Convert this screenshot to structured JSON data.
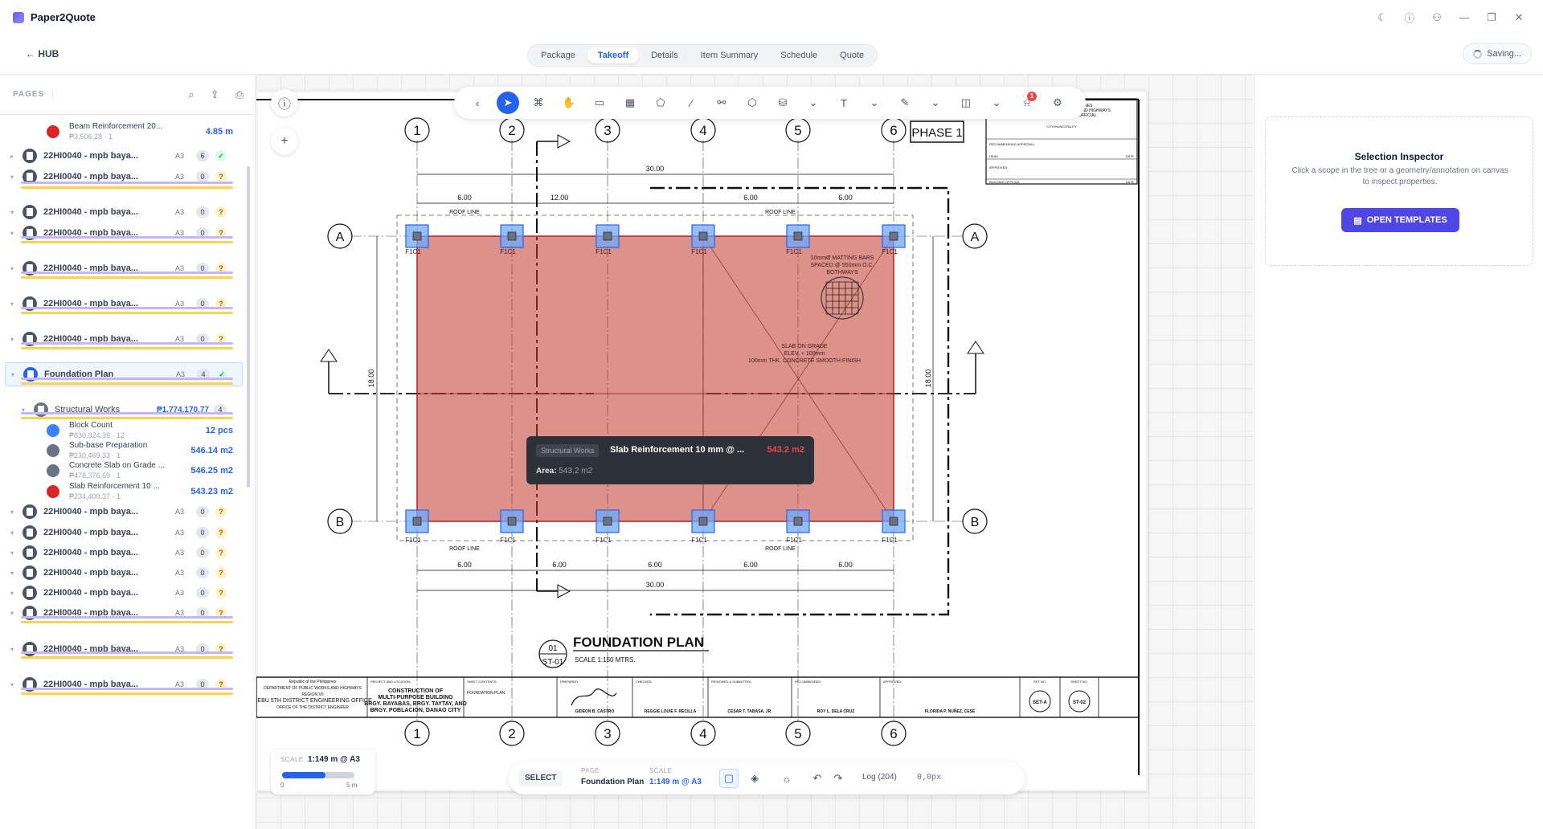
{
  "app": {
    "name": "Paper2Quote"
  },
  "nav": {
    "hub": "← HUB",
    "tabs": [
      "Package",
      "Takeoff",
      "Details",
      "Item Summary",
      "Schedule",
      "Quote"
    ],
    "saving": "Saving..."
  },
  "left": {
    "pages_label": "PAGES",
    "top_item": {
      "name": "Beam Reinforcement 20...",
      "cost": "₱3,506.28 · 1",
      "value": "4.85 m"
    },
    "pages": [
      {
        "label": "22HI0040 - mpb baya...",
        "size": "A3",
        "count": "6",
        "status": "✓"
      },
      {
        "label": "22HI0040 - mpb baya...",
        "size": "A3",
        "count": "0",
        "status": "?"
      },
      {
        "label": "22HI0040 - mpb baya...",
        "size": "A3",
        "count": "0",
        "status": "?"
      },
      {
        "label": "22HI0040 - mpb baya...",
        "size": "A3",
        "count": "0",
        "status": "?"
      },
      {
        "label": "22HI0040 - mpb baya...",
        "size": "A3",
        "count": "0",
        "status": "?"
      },
      {
        "label": "22HI0040 - mpb baya...",
        "size": "A3",
        "count": "0",
        "status": "?"
      },
      {
        "label": "22HI0040 - mpb baya...",
        "size": "A3",
        "count": "0",
        "status": "?"
      },
      {
        "label": "Foundation Plan",
        "size": "A3",
        "count": "4",
        "status": "✓"
      },
      {
        "label": "22HI0040 - mpb baya...",
        "size": "A3",
        "count": "0",
        "status": "?"
      },
      {
        "label": "22HI0040 - mpb baya...",
        "size": "A3",
        "count": "0",
        "status": "?"
      },
      {
        "label": "22HI0040 - mpb baya...",
        "size": "A3",
        "count": "0",
        "status": "?"
      },
      {
        "label": "22HI0040 - mpb baya...",
        "size": "A3",
        "count": "0",
        "status": "?"
      },
      {
        "label": "22HI0040 - mpb baya...",
        "size": "A3",
        "count": "0",
        "status": "?"
      },
      {
        "label": "22HI0040 - mpb baya...",
        "size": "A3",
        "count": "0",
        "status": "?"
      },
      {
        "label": "22HI0040 - mpb baya...",
        "size": "A3",
        "count": "0",
        "status": "?"
      },
      {
        "label": "22HI0040 - mpb baya...",
        "size": "A3",
        "count": "0",
        "status": "?"
      }
    ],
    "group": {
      "name": "Structural Works",
      "total": "₱1,774,170.77",
      "count": "4"
    },
    "items": [
      {
        "name": "Block Count",
        "cost": "₱830,924.39 · 12",
        "value": "12 pcs",
        "color": "#3b82f6"
      },
      {
        "name": "Sub-base Preparation",
        "cost": "₱230,469.33 · 1",
        "value": "546.14 m2",
        "color": "#6b7280"
      },
      {
        "name": "Concrete Slab on Grade ...",
        "cost": "₱478,376.69 · 1",
        "value": "546.25 m2",
        "color": "#6b7280"
      },
      {
        "name": "Slab Reinforcement 10 ...",
        "cost": "₱234,400.37 · 1",
        "value": "543.23 m2",
        "color": "#dc2626"
      }
    ]
  },
  "drawing": {
    "grid_numbers": [
      "1",
      "2",
      "3",
      "4",
      "5",
      "6"
    ],
    "grid_letters": [
      "A",
      "B"
    ],
    "phase": "PHASE 1",
    "dims_top": [
      "6.00",
      "12.00",
      "6.00",
      "6.00"
    ],
    "dims_bottom": [
      "6.00",
      "6.00",
      "6.00",
      "6.00",
      "6.00"
    ],
    "dim_total": "30.00",
    "dim_side": "18.00",
    "roof_line": "ROOF LINE",
    "footing": "F1C1",
    "note_bars": [
      "10mmØ MATTING BARS",
      "SPACED @ 550mm O.C.",
      "BOTHWAYS"
    ],
    "note_slab": [
      "SLAB ON GRADE",
      "ELEV. + 100mm",
      "100mm THK. CONCRETE SMOOTH FINISH"
    ],
    "title": "FOUNDATION PLAN",
    "scale": "SCALE 1:150 MTRS.",
    "detail_num": "01",
    "detail_sheet": "ST-01",
    "title_block": {
      "agency": [
        "Republic of the Philippines",
        "DEPARTMENT OF PUBLIC WORKS AND HIGHWAYS",
        "REGION VII",
        "CEBU 5TH DISTRICT ENGINEERING OFFICE",
        "OFFICE OF THE DISTRICT ENGINEER"
      ],
      "project_label": "PROJECT AND LOCATION:",
      "project": [
        "CONSTRUCTION OF",
        "MULTI-PURPOSE BUILDING",
        "BRGY. BAYABAS, BRGY. TAYTAY, AND",
        "BRGY. POBLACION, DANAO CITY"
      ],
      "sheet_contents_label": "SHEET CONTENTS:",
      "sheet_contents": "FOUNDATION PLAN",
      "prepared_label": "PREPARED:",
      "prepared": "GIDEON B. CASTRO",
      "checked_label": "CHECKED:",
      "checked": "REGGIE LOUIE F. RECILLA",
      "reviewed_label": "REVIEWED & SUBMITTED:",
      "reviewed": "CESAR T. TABASA, JR.",
      "recommended_label": "RECOMMENDED:",
      "recommended": "ROY L. DELA CRUZ",
      "approved_label": "APPROVED:",
      "approved": "FLORIDA P. NUÑEZ, CESE",
      "set_no_label": "SET NO.",
      "set_no": "SET-A",
      "sheet_no_label": "SHEET NO.",
      "sheet_no": "ST-02"
    },
    "permit_block": {
      "header": [
        "REPUBLIC OF THE PHILIPPINES",
        "DEPARTMENT OF PUBLIC WORKS AND HIGHWAYS",
        "OFFICE OF THE BUILDING OFFICIAL"
      ],
      "city": "CITY/MUNICIPALITY",
      "recommending": "RECOMMENDING APPROVAL:",
      "head": "HEAD",
      "approved": "APPROVED:",
      "official": "BUILDING OFFICIAL",
      "date": "DATE"
    }
  },
  "tooltip": {
    "chip": "Structural Works",
    "title": "Slab Reinforcement 10 mm @ ...",
    "value": "543.2 m2",
    "area_label": "Area:",
    "area_value": "543.2 m2"
  },
  "scalebox": {
    "label": "SCALE",
    "value": "1:149 m @ A3",
    "min": "0",
    "max": "5 m",
    "fill_fraction": 0.6
  },
  "status": {
    "select": "SELECT",
    "page_label": "PAGE",
    "page_value": "Foundation Plan",
    "scale_label": "SCALE",
    "scale_value": "1:149 m @ A3",
    "log": "Log (204)",
    "coords": "0,0px"
  },
  "inspector": {
    "title": "Selection Inspector",
    "desc": "Click a scope in the tree or a geometry/annotation on canvas to inspect properties.",
    "button": "OPEN TEMPLATES"
  },
  "notifications": {
    "count": "1"
  },
  "colors": {
    "accent": "#2563eb",
    "area_fill": "#c0392b",
    "footing": "#6fa8ff",
    "button": "#4f46e5"
  }
}
